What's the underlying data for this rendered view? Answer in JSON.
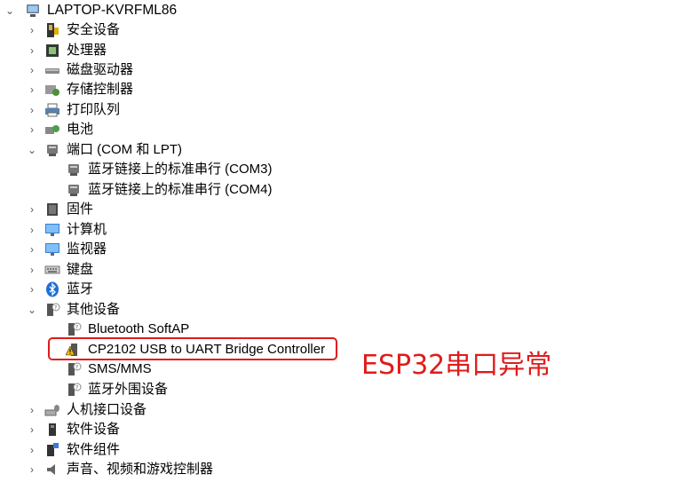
{
  "tree": {
    "root": {
      "label": "LAPTOP-KVRFML86",
      "icon": "computer-icon"
    },
    "items": [
      {
        "label": "安全设备",
        "icon": "security-device-icon",
        "expanded": false
      },
      {
        "label": "处理器",
        "icon": "processor-icon",
        "expanded": false
      },
      {
        "label": "磁盘驱动器",
        "icon": "disk-drive-icon",
        "expanded": false
      },
      {
        "label": "存储控制器",
        "icon": "storage-controller-icon",
        "expanded": false
      },
      {
        "label": "打印队列",
        "icon": "printer-icon",
        "expanded": false
      },
      {
        "label": "电池",
        "icon": "battery-icon",
        "expanded": false
      },
      {
        "label": "端口 (COM 和 LPT)",
        "icon": "port-icon",
        "expanded": true,
        "children": [
          {
            "label": "蓝牙链接上的标准串行 (COM3)",
            "icon": "port-icon"
          },
          {
            "label": "蓝牙链接上的标准串行 (COM4)",
            "icon": "port-icon"
          }
        ]
      },
      {
        "label": "固件",
        "icon": "firmware-icon",
        "expanded": false
      },
      {
        "label": "计算机",
        "icon": "monitor-icon",
        "expanded": false
      },
      {
        "label": "监视器",
        "icon": "monitor-icon",
        "expanded": false
      },
      {
        "label": "键盘",
        "icon": "keyboard-icon",
        "expanded": false
      },
      {
        "label": "蓝牙",
        "icon": "bluetooth-icon",
        "expanded": false
      },
      {
        "label": "其他设备",
        "icon": "unknown-device-icon",
        "expanded": true,
        "children": [
          {
            "label": "Bluetooth SoftAP",
            "icon": "unknown-device-icon"
          },
          {
            "label": "CP2102 USB to UART Bridge Controller",
            "icon": "warning-device-icon"
          },
          {
            "label": "SMS/MMS",
            "icon": "unknown-device-icon"
          },
          {
            "label": "蓝牙外围设备",
            "icon": "unknown-device-icon"
          }
        ]
      },
      {
        "label": "人机接口设备",
        "icon": "hid-icon",
        "expanded": false
      },
      {
        "label": "软件设备",
        "icon": "software-device-icon",
        "expanded": false
      },
      {
        "label": "软件组件",
        "icon": "software-component-icon",
        "expanded": false
      },
      {
        "label": "声音、视频和游戏控制器",
        "icon": "speaker-icon",
        "expanded": false
      }
    ]
  },
  "annotation": {
    "text": "ESP32串口异常",
    "color": "#e01b1b"
  }
}
